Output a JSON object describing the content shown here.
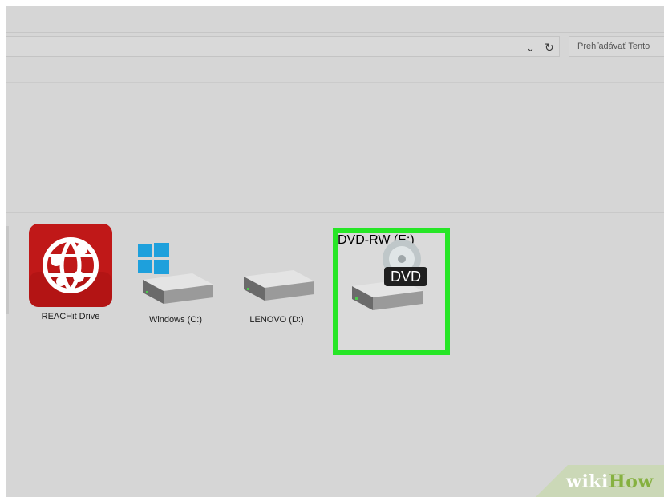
{
  "toolbar": {
    "search_placeholder": "Prehľadávať Tento",
    "dropdown_icon": "chevron-down-icon",
    "refresh_icon": "refresh-icon"
  },
  "drives": [
    {
      "label": "REACHit Drive",
      "icon": "reachit-logo-icon"
    },
    {
      "label": "Windows (C:)",
      "icon": "windows-drive-icon"
    },
    {
      "label": "LENOVO (D:)",
      "icon": "hard-drive-icon"
    },
    {
      "label": "DVD-RW (E:)",
      "icon": "dvd-drive-icon",
      "badge": "DVD",
      "highlighted": true
    }
  ],
  "watermark": {
    "wiki": "wiki",
    "how": "How"
  },
  "colors": {
    "highlight": "#26e626",
    "reachit_red": "#c01818",
    "windows_blue": "#1ea0dc",
    "wikihow_green": "#86b140"
  }
}
